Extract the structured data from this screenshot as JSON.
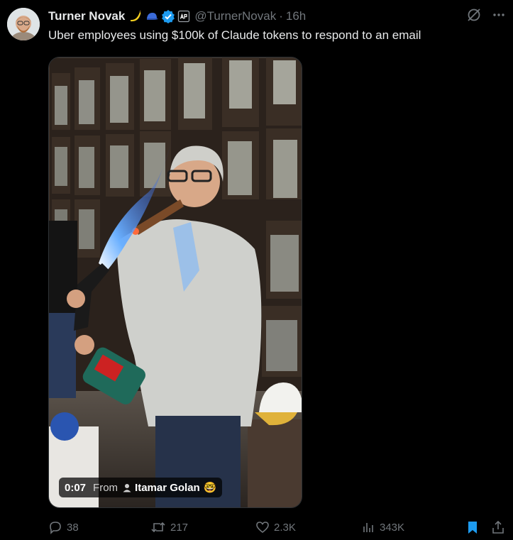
{
  "author": {
    "name": "Turner Novak",
    "handle": "@TurnerNovak",
    "time": "16h",
    "badge_emojis": [
      "banana-emoji",
      "cap-emoji"
    ],
    "verified_color": "#1d9bf0"
  },
  "separator": "·",
  "tweet_text": "Uber employees using $100k of Claude tokens to respond to an email",
  "video": {
    "timestamp": "0:07",
    "from_label": "From",
    "from_user": "Itamar Golan",
    "from_user_emoji": "🤓"
  },
  "actions": {
    "replies": "38",
    "reposts": "217",
    "likes": "2.3K",
    "views": "343K"
  },
  "colors": {
    "background": "#000000",
    "text_primary": "#e7e9ea",
    "text_secondary": "#71767b",
    "accent_blue": "#1d9bf0"
  }
}
